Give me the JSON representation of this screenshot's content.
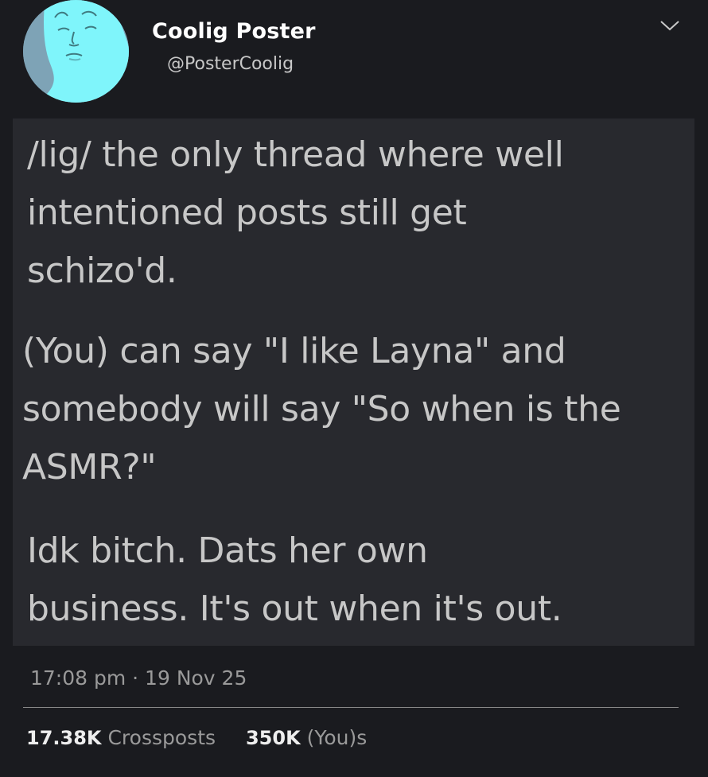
{
  "author": {
    "display_name": "Coolig Poster",
    "handle": "@PosterCoolig"
  },
  "icons": {
    "menu": "chevron-down-icon",
    "avatar": "cyan-face-portrait"
  },
  "post": {
    "paragraphs": [
      [
        "/lig/ the only thread where well",
        "intentioned posts still get",
        "schizo'd."
      ],
      [
        "(You) can say \"I like Layna\" and",
        "somebody will say \"So when is the",
        "ASMR?\""
      ],
      [
        "Idk bitch. Dats her own",
        "business. It's out when it's out."
      ]
    ]
  },
  "meta": {
    "timestamp": "17:08 pm · 19 Nov 25"
  },
  "stats": {
    "crossposts_count": "17.38K",
    "crossposts_label": "Crossposts",
    "yous_count": "350K",
    "yous_label": "(You)s"
  },
  "colors": {
    "background": "#1a1b1f",
    "post_panel": "#28292e",
    "avatar_face": "#7ff5fb"
  }
}
